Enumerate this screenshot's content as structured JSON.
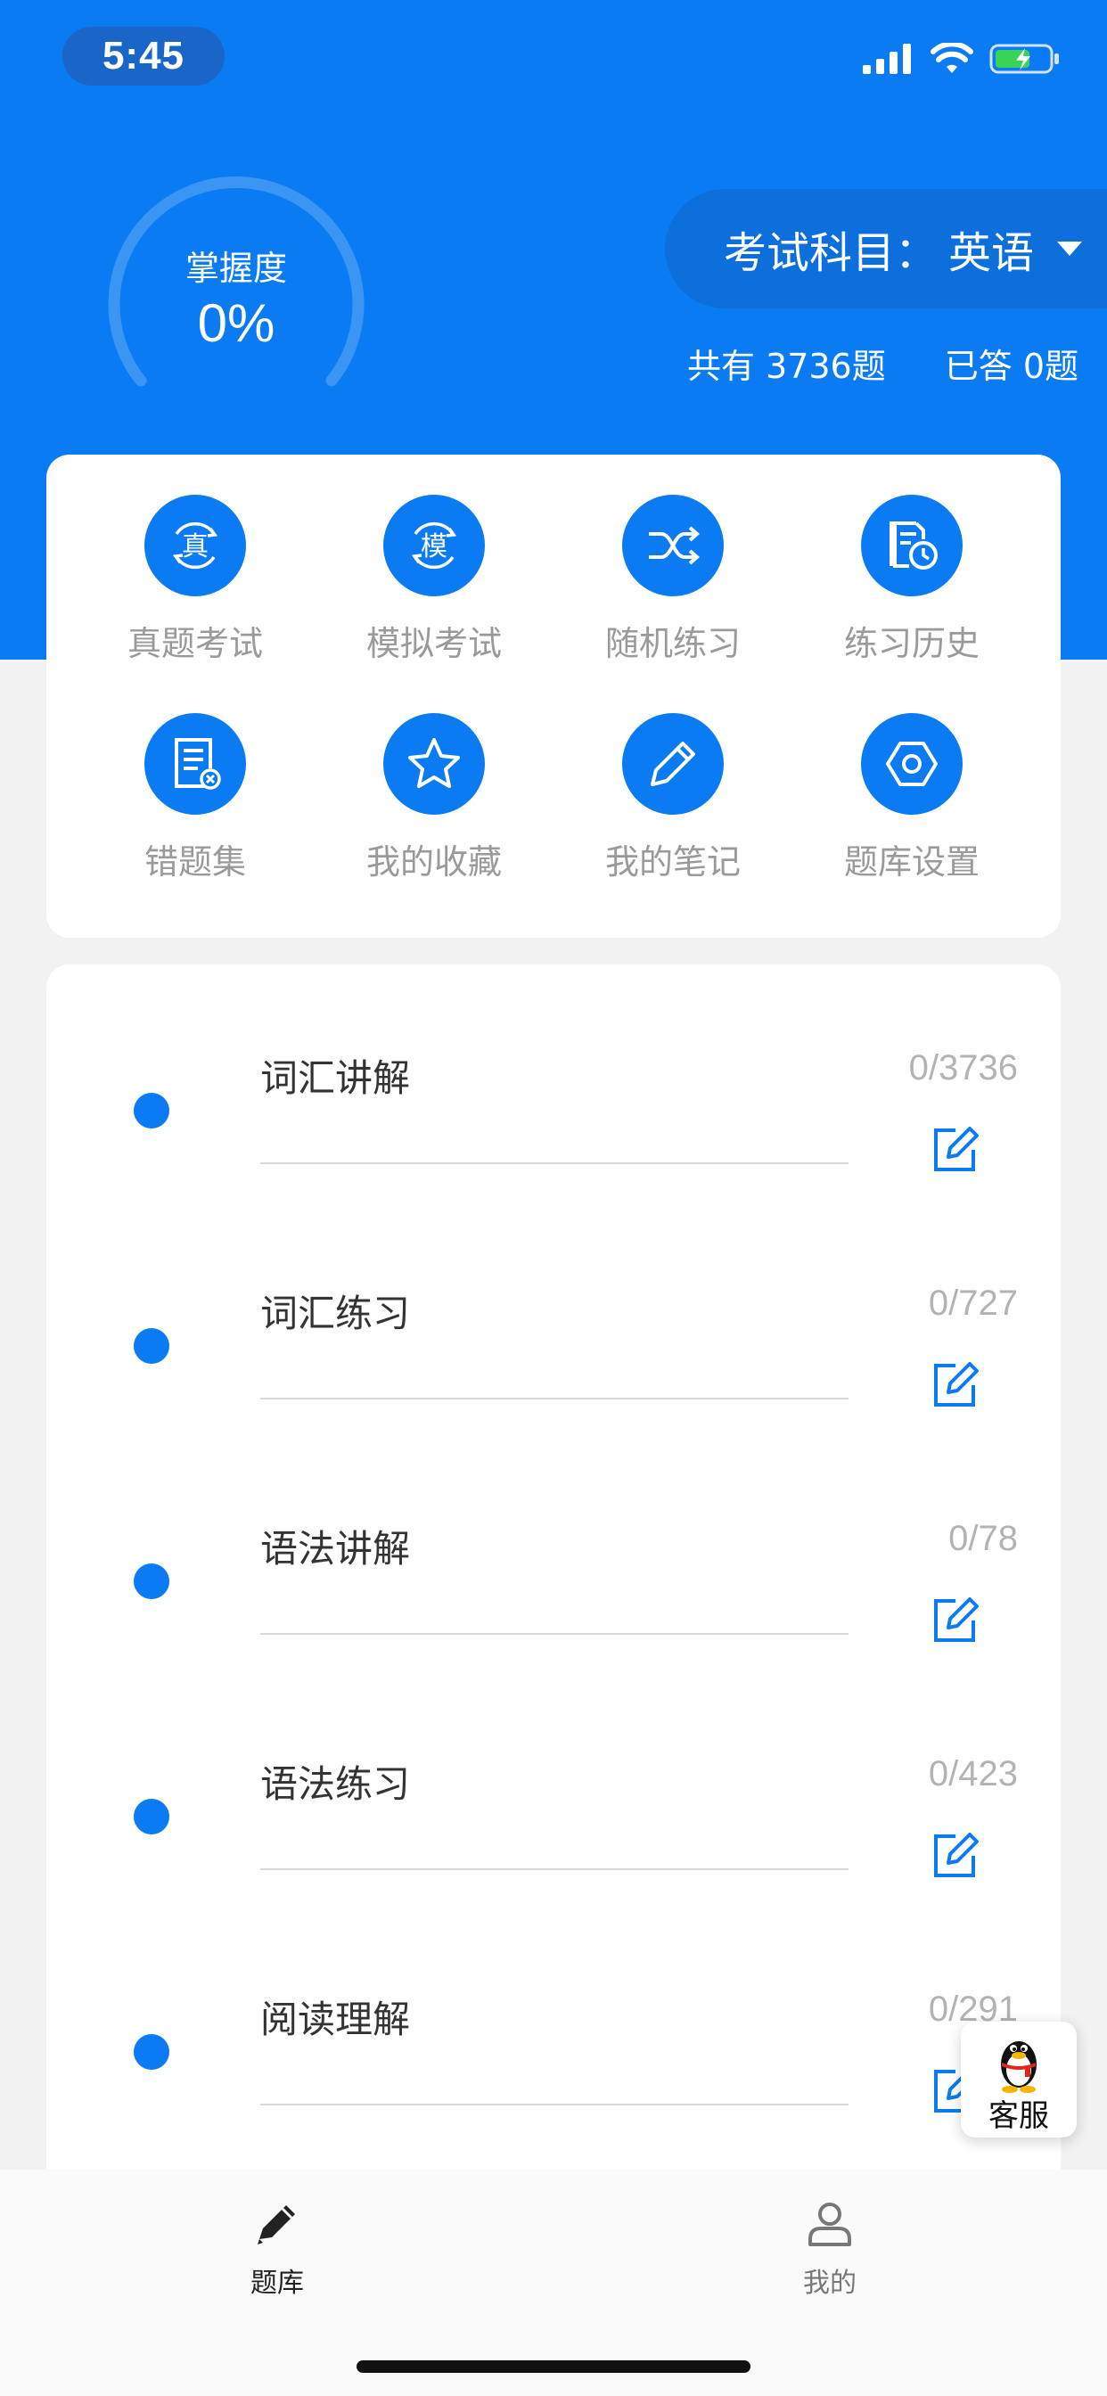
{
  "status_bar": {
    "time": "5:45"
  },
  "header": {
    "mastery_title": "掌握度",
    "mastery_value": "0%",
    "subject_label": "考试科目：",
    "subject_value": "英语",
    "total_questions": "共有 3736题",
    "answered": "已答 0题"
  },
  "features": [
    {
      "label": "真题考试",
      "icon": "real-exam-icon",
      "glyph": "真"
    },
    {
      "label": "模拟考试",
      "icon": "mock-exam-icon",
      "glyph": "模"
    },
    {
      "label": "随机练习",
      "icon": "shuffle-icon"
    },
    {
      "label": "练习历史",
      "icon": "history-icon"
    },
    {
      "label": "错题集",
      "icon": "wrong-questions-icon"
    },
    {
      "label": "我的收藏",
      "icon": "star-icon"
    },
    {
      "label": "我的笔记",
      "icon": "pencil-icon"
    },
    {
      "label": "题库设置",
      "icon": "settings-icon"
    }
  ],
  "categories": [
    {
      "title": "词汇讲解",
      "count": "0/3736"
    },
    {
      "title": "词汇练习",
      "count": "0/727"
    },
    {
      "title": "语法讲解",
      "count": "0/78"
    },
    {
      "title": "语法练习",
      "count": "0/423"
    },
    {
      "title": "阅读理解",
      "count": "0/291"
    }
  ],
  "service": {
    "label": "客服"
  },
  "tabbar": {
    "tabs": [
      {
        "label": "题库",
        "icon": "pencil-tab-icon",
        "active": true
      },
      {
        "label": "我的",
        "icon": "user-tab-icon",
        "active": false
      }
    ]
  },
  "colors": {
    "primary": "#0a7bf2",
    "background": "#f2f2f2"
  }
}
